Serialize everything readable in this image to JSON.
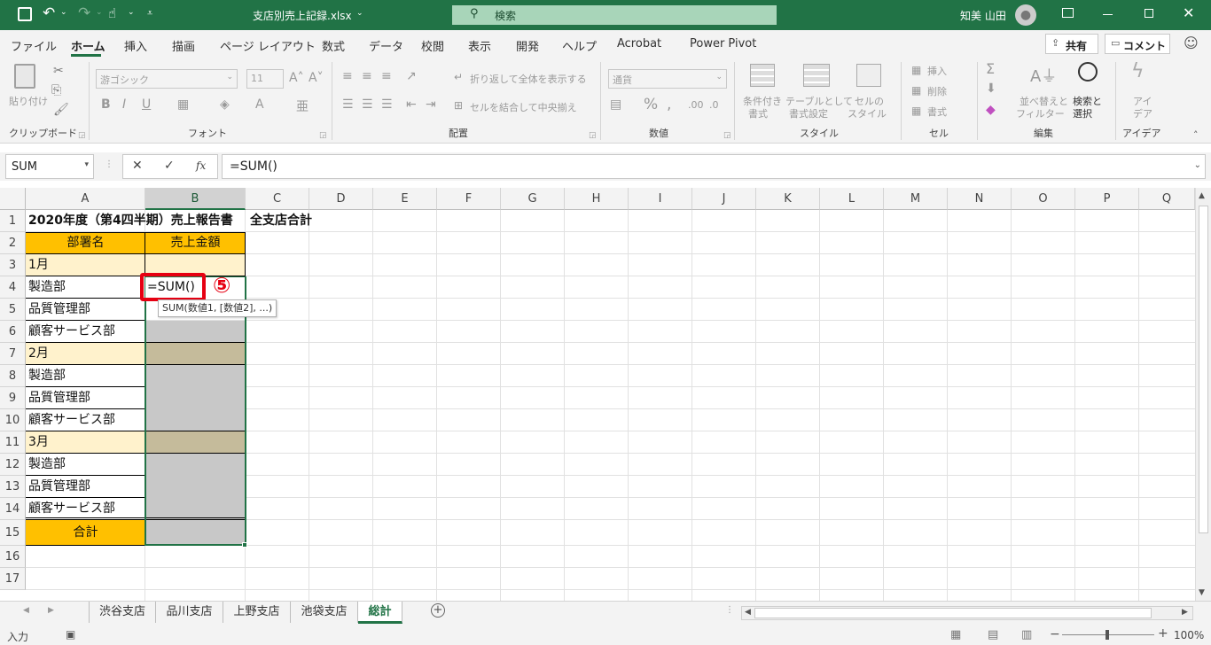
{
  "titlebar": {
    "filename": "支店別売上記録.xlsx",
    "search_placeholder": "検索",
    "user": "知美 山田"
  },
  "tabs": [
    "ファイル",
    "ホーム",
    "挿入",
    "描画",
    "ページ レイアウト",
    "数式",
    "データ",
    "校閲",
    "表示",
    "開発",
    "ヘルプ",
    "Acrobat",
    "Power Pivot"
  ],
  "share_label": "共有",
  "comment_label": "コメント",
  "ribbon": {
    "clipboard": {
      "paste": "貼り付け",
      "group": "クリップボード"
    },
    "font": {
      "name": "游ゴシック",
      "size": "11",
      "group": "フォント"
    },
    "alignment": {
      "wrap": "折り返して全体を表示する",
      "merge": "セルを結合して中央揃え",
      "group": "配置"
    },
    "number": {
      "format": "通貨",
      "group": "数値"
    },
    "styles": {
      "conditional": [
        "条件付き",
        "書式"
      ],
      "table": [
        "テーブルとして",
        "書式設定"
      ],
      "cell": [
        "セルの",
        "スタイル"
      ],
      "group": "スタイル"
    },
    "cells": {
      "insert": "挿入",
      "delete": "削除",
      "format": "書式",
      "group": "セル"
    },
    "editing": {
      "sort": [
        "並べ替えと",
        "フィルター"
      ],
      "find": [
        "検索と",
        "選択"
      ],
      "group": "編集"
    },
    "ideas": {
      "label": [
        "アイ",
        "デア"
      ],
      "group": "アイデア"
    }
  },
  "formula_bar": {
    "name_box": "SUM",
    "fx": "fx",
    "content": "=SUM()"
  },
  "columns": [
    "A",
    "B",
    "C",
    "D",
    "E",
    "F",
    "G",
    "H",
    "I",
    "J",
    "K",
    "L",
    "M",
    "N",
    "O",
    "P",
    "Q"
  ],
  "rows": [
    "1",
    "2",
    "3",
    "4",
    "5",
    "6",
    "7",
    "8",
    "9",
    "10",
    "11",
    "12",
    "13",
    "14",
    "15",
    "16",
    "17"
  ],
  "sheet": {
    "title": "2020年度（第4四半期）売上報告書",
    "c1": "全支店合計",
    "header_dept": "部署名",
    "header_sales": "売上金額",
    "a3": "1月",
    "a4": "製造部",
    "a5": "品質管理部",
    "a6": "顧客サービス部",
    "a7": "2月",
    "a8": "製造部",
    "a9": "品質管理部",
    "a10": "顧客サービス部",
    "a11": "3月",
    "a12": "製造部",
    "a13": "品質管理部",
    "a14": "顧客サービス部",
    "a15": "合計",
    "editing_cell": "=SUM()",
    "tooltip": "SUM(数値1, [数値2], ...)",
    "step_marker": "⑤"
  },
  "sheet_tabs": [
    "渋谷支店",
    "品川支店",
    "上野支店",
    "池袋支店",
    "総計"
  ],
  "active_sheet": "総計",
  "status": {
    "mode": "入力",
    "zoom": "100%"
  },
  "colors": {
    "excel_green": "#217346",
    "header_orange": "#ffc000",
    "month_fill": "#fff2cc",
    "selection_gray": "#c8c8c8",
    "marker_red": "#e60012"
  }
}
